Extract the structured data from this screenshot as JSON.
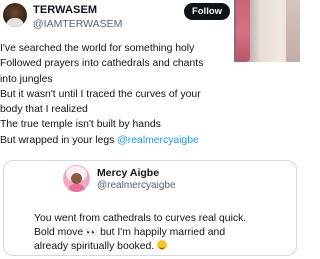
{
  "post": {
    "author_name": "TERWASEM",
    "author_handle": "@IAMTERWASEM",
    "follow_label": "Follow",
    "lines": [
      "I've searched the world for something holy",
      "Followed prayers into cathedrals and chants",
      "into jungles",
      "But it wasn't until I traced the curves of your",
      "body that I realized",
      "The true temple isn't built by hands"
    ],
    "last_line_prefix": "But wrapped in your legs ",
    "mention": "@realmercyaigbe"
  },
  "quote": {
    "author_name": "Mercy Aigbe",
    "author_handle": "@realmercyaigbe",
    "line1": "You went from cathedrals to curves real quick.",
    "line2_prefix": "Bold move ",
    "line2_emoji": "👀",
    "line2_suffix": " but I'm happily married and",
    "line3": "already spiritually booked. ",
    "line3_emoji": "🙂"
  },
  "colors": {
    "text": "#0f1419",
    "secondary": "#536471",
    "mention": "#1d9bf0",
    "follow_bg": "#0f1419",
    "border": "#cfd9de"
  },
  "icons": [
    "author-avatar",
    "quote-author-avatar",
    "eyes-emoji",
    "smiling-face-emoji"
  ]
}
